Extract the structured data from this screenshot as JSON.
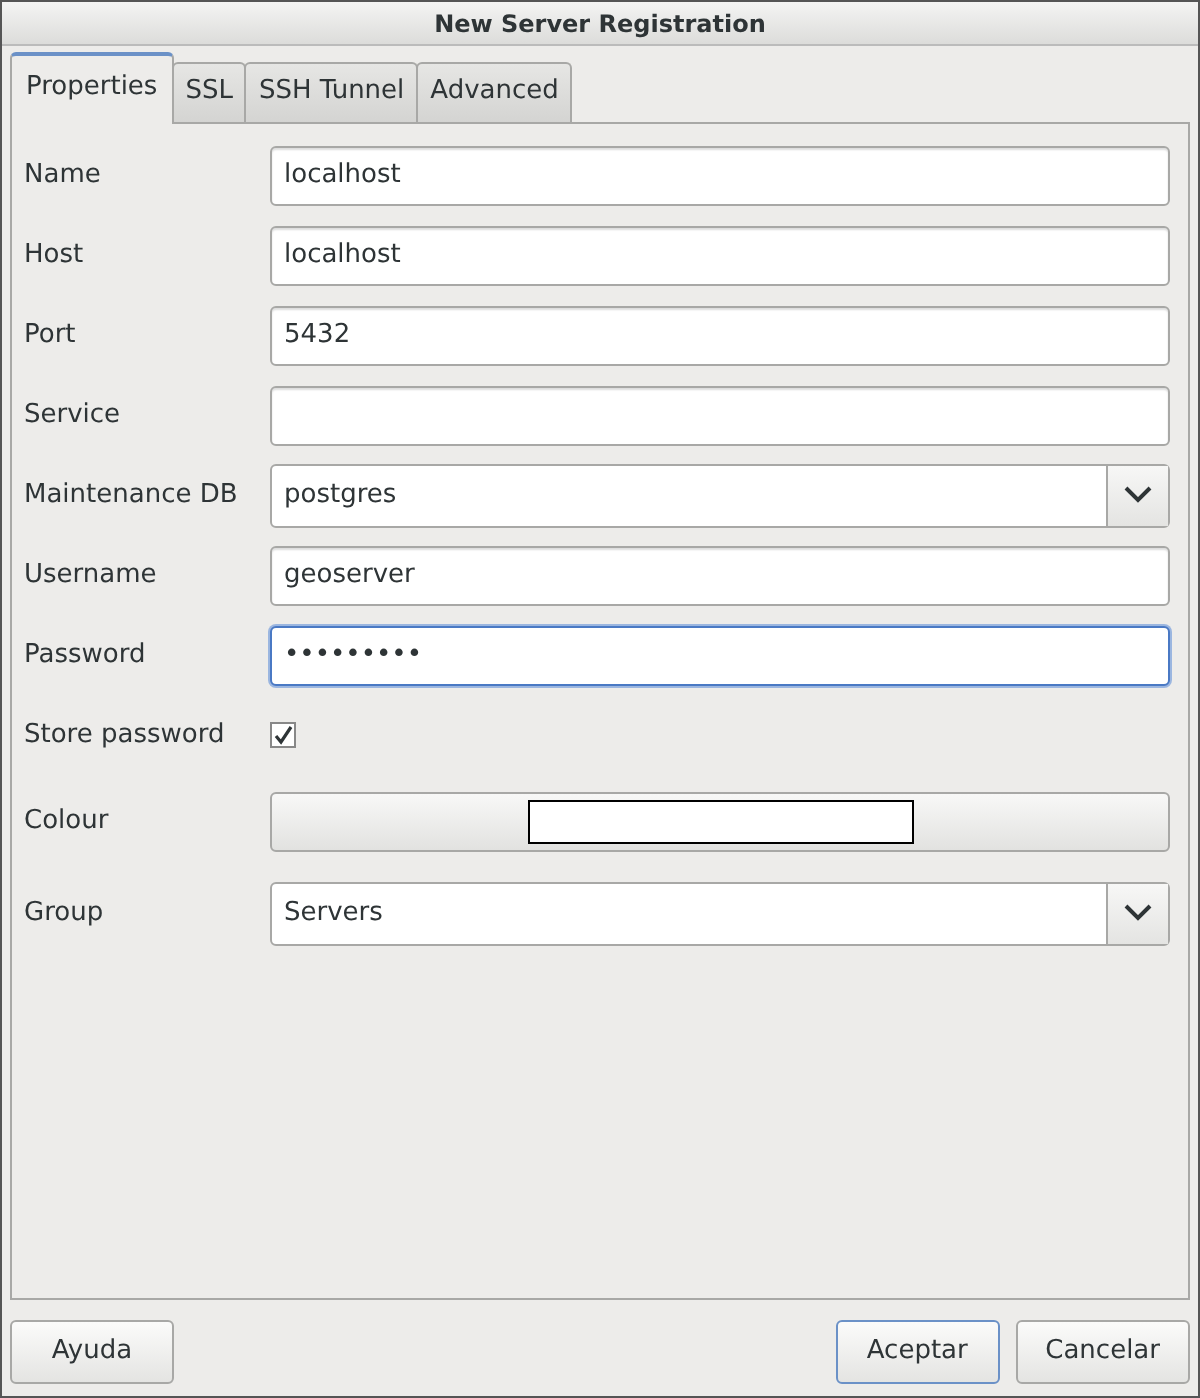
{
  "window": {
    "title": "New Server Registration"
  },
  "tabs": [
    {
      "label": "Properties",
      "selected": true
    },
    {
      "label": "SSL",
      "selected": false
    },
    {
      "label": "SSH Tunnel",
      "selected": false
    },
    {
      "label": "Advanced",
      "selected": false
    }
  ],
  "fields": [
    {
      "kind": "text",
      "label": "Name",
      "value": "localhost",
      "focused": false
    },
    {
      "kind": "text",
      "label": "Host",
      "value": "localhost",
      "focused": false
    },
    {
      "kind": "text",
      "label": "Port",
      "value": "5432",
      "focused": false
    },
    {
      "kind": "text",
      "label": "Service",
      "focused": false
    },
    {
      "kind": "combo",
      "label": "Maintenance DB",
      "value": "postgres",
      "focused": false
    },
    {
      "kind": "text",
      "label": "Username",
      "value": "geoserver",
      "focused": false
    },
    {
      "kind": "password",
      "label": "Password",
      "value": "•••••••••",
      "focused": true
    },
    {
      "kind": "checkbox",
      "label": "Store password",
      "checked": true
    },
    {
      "kind": "colour",
      "label": "Colour",
      "color": "#ffffff"
    },
    {
      "kind": "combo",
      "label": "Group",
      "value": "Servers",
      "focused": false
    }
  ],
  "left_buttons": [
    {
      "label": "Ayuda",
      "default": false
    }
  ],
  "right_buttons": [
    {
      "label": "Aceptar",
      "default": true
    },
    {
      "label": "Cancelar",
      "default": false
    }
  ]
}
